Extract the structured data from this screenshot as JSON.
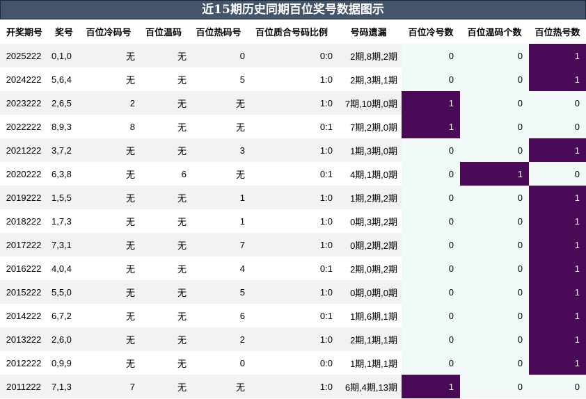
{
  "title": "近15期历史同期百位奖号数据图示",
  "headers": [
    "开奖期号",
    "奖号",
    "百位冷码号",
    "百位温码",
    "百位热码号",
    "百位质合号码比例",
    "号码遗漏",
    "百位冷号数",
    "百位温码个数",
    "百位热号数"
  ],
  "colors": {
    "title_bg": "#44546a",
    "highlight": "#4b0a57",
    "count_bg": "#f2faf9",
    "stripe": "#f2f2f2"
  },
  "rows": [
    {
      "period": "2025222",
      "nums": "0,1,0",
      "cold": "无",
      "warm": "无",
      "hot": "0",
      "ratio": "0:0",
      "miss": "2期,8期,2期",
      "cold_count": "0",
      "warm_count": "0",
      "hot_count": "1"
    },
    {
      "period": "2024222",
      "nums": "5,6,4",
      "cold": "无",
      "warm": "无",
      "hot": "5",
      "ratio": "1:0",
      "miss": "2期,3期,1期",
      "cold_count": "0",
      "warm_count": "0",
      "hot_count": "1"
    },
    {
      "period": "2023222",
      "nums": "2,6,5",
      "cold": "2",
      "warm": "无",
      "hot": "无",
      "ratio": "1:0",
      "miss": "7期,10期,0期",
      "cold_count": "1",
      "warm_count": "0",
      "hot_count": "0"
    },
    {
      "period": "2022222",
      "nums": "8,9,3",
      "cold": "8",
      "warm": "无",
      "hot": "无",
      "ratio": "0:1",
      "miss": "7期,2期,0期",
      "cold_count": "1",
      "warm_count": "0",
      "hot_count": "0"
    },
    {
      "period": "2021222",
      "nums": "3,7,2",
      "cold": "无",
      "warm": "无",
      "hot": "3",
      "ratio": "1:0",
      "miss": "1期,3期,0期",
      "cold_count": "0",
      "warm_count": "0",
      "hot_count": "1"
    },
    {
      "period": "2020222",
      "nums": "6,3,8",
      "cold": "无",
      "warm": "6",
      "hot": "无",
      "ratio": "0:1",
      "miss": "4期,1期,0期",
      "cold_count": "0",
      "warm_count": "1",
      "hot_count": "0"
    },
    {
      "period": "2019222",
      "nums": "1,5,5",
      "cold": "无",
      "warm": "无",
      "hot": "1",
      "ratio": "1:0",
      "miss": "1期,2期,2期",
      "cold_count": "0",
      "warm_count": "0",
      "hot_count": "1"
    },
    {
      "period": "2018222",
      "nums": "1,7,3",
      "cold": "无",
      "warm": "无",
      "hot": "1",
      "ratio": "1:0",
      "miss": "0期,3期,2期",
      "cold_count": "0",
      "warm_count": "0",
      "hot_count": "1"
    },
    {
      "period": "2017222",
      "nums": "7,3,1",
      "cold": "无",
      "warm": "无",
      "hot": "7",
      "ratio": "1:0",
      "miss": "0期,2期,2期",
      "cold_count": "0",
      "warm_count": "0",
      "hot_count": "1"
    },
    {
      "period": "2016222",
      "nums": "4,0,4",
      "cold": "无",
      "warm": "无",
      "hot": "4",
      "ratio": "0:1",
      "miss": "2期,0期,2期",
      "cold_count": "0",
      "warm_count": "0",
      "hot_count": "1"
    },
    {
      "period": "2015222",
      "nums": "5,5,0",
      "cold": "无",
      "warm": "无",
      "hot": "5",
      "ratio": "1:0",
      "miss": "0期,0期,0期",
      "cold_count": "0",
      "warm_count": "0",
      "hot_count": "1"
    },
    {
      "period": "2014222",
      "nums": "6,7,2",
      "cold": "无",
      "warm": "无",
      "hot": "6",
      "ratio": "0:1",
      "miss": "1期,6期,1期",
      "cold_count": "0",
      "warm_count": "0",
      "hot_count": "1"
    },
    {
      "period": "2013222",
      "nums": "2,6,0",
      "cold": "无",
      "warm": "无",
      "hot": "2",
      "ratio": "1:0",
      "miss": "2期,1期,1期",
      "cold_count": "0",
      "warm_count": "0",
      "hot_count": "1"
    },
    {
      "period": "2012222",
      "nums": "0,9,9",
      "cold": "无",
      "warm": "无",
      "hot": "0",
      "ratio": "0:0",
      "miss": "1期,1期,1期",
      "cold_count": "0",
      "warm_count": "0",
      "hot_count": "1"
    },
    {
      "period": "2011222",
      "nums": "7,1,3",
      "cold": "7",
      "warm": "无",
      "hot": "无",
      "ratio": "1:0",
      "miss": "6期,4期,13期",
      "cold_count": "1",
      "warm_count": "0",
      "hot_count": "0"
    }
  ]
}
